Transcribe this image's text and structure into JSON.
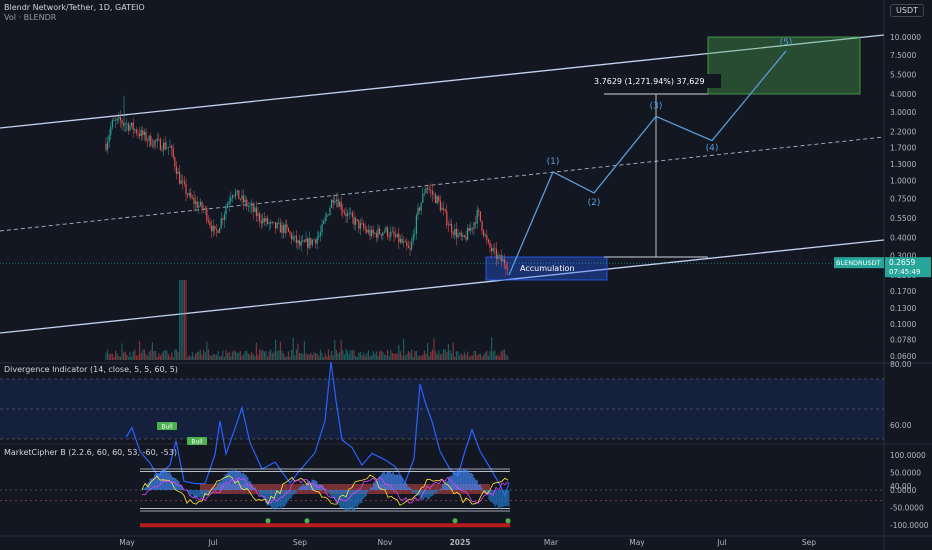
{
  "header": {
    "title": "Blendr Network/Tether, 1D, GATEIO",
    "vol_label": "Vol · BLENDR",
    "currency": "USDT"
  },
  "colors": {
    "bg": "#131722",
    "up": "#26a69a",
    "down": "#ef5350",
    "line": "#c3d3f0",
    "wave": "#5b9bd5",
    "target": "#4caf50",
    "blue": "#2962ff"
  },
  "chart_data": [
    {
      "type": "line",
      "yscale": "log",
      "price_ticks": [
        "10.0000",
        "7.5000",
        "5.5000",
        "4.0000",
        "3.0000",
        "2.2000",
        "1.7000",
        "1.3000",
        "1.0000",
        "0.7500",
        "0.5500",
        "0.4000",
        "0.3000",
        "0.2200",
        "0.1700",
        "0.1300",
        "0.1000",
        "0.0780",
        "0.0600"
      ],
      "x_ticks": [
        "May",
        "Jul",
        "Sep",
        "Nov",
        "2025",
        "Mar",
        "May",
        "Jul",
        "Sep"
      ],
      "last_symbol": "BLENDRUSDT",
      "last_price": "0.2659",
      "countdown": "07:45:49",
      "measure_label": "3.7629 (1,271.94%) 37,629",
      "box_label": "Accumulation",
      "waves": [
        {
          "label": "(1)",
          "price": 1.15
        },
        {
          "label": "(2)",
          "price": 0.82
        },
        {
          "label": "(3)",
          "price": 2.8
        },
        {
          "label": "(4)",
          "price": 1.9
        },
        {
          "label": "(5)",
          "price": 8.0
        }
      ]
    },
    {
      "type": "line",
      "title": "Divergence Indicator (14, close, 5, 5, 60, 5)",
      "y_ticks": [
        "80.00",
        "60.00",
        "40.00"
      ],
      "labels": [
        "Bull",
        "Bull"
      ]
    },
    {
      "type": "area",
      "title": "MarketCipher B (2.2.6, 60, 60, 53, -60, -53)",
      "y_ticks": [
        "100.0000",
        "50.0000",
        "0.0000",
        "-50.0000",
        "-100.0000"
      ]
    }
  ]
}
